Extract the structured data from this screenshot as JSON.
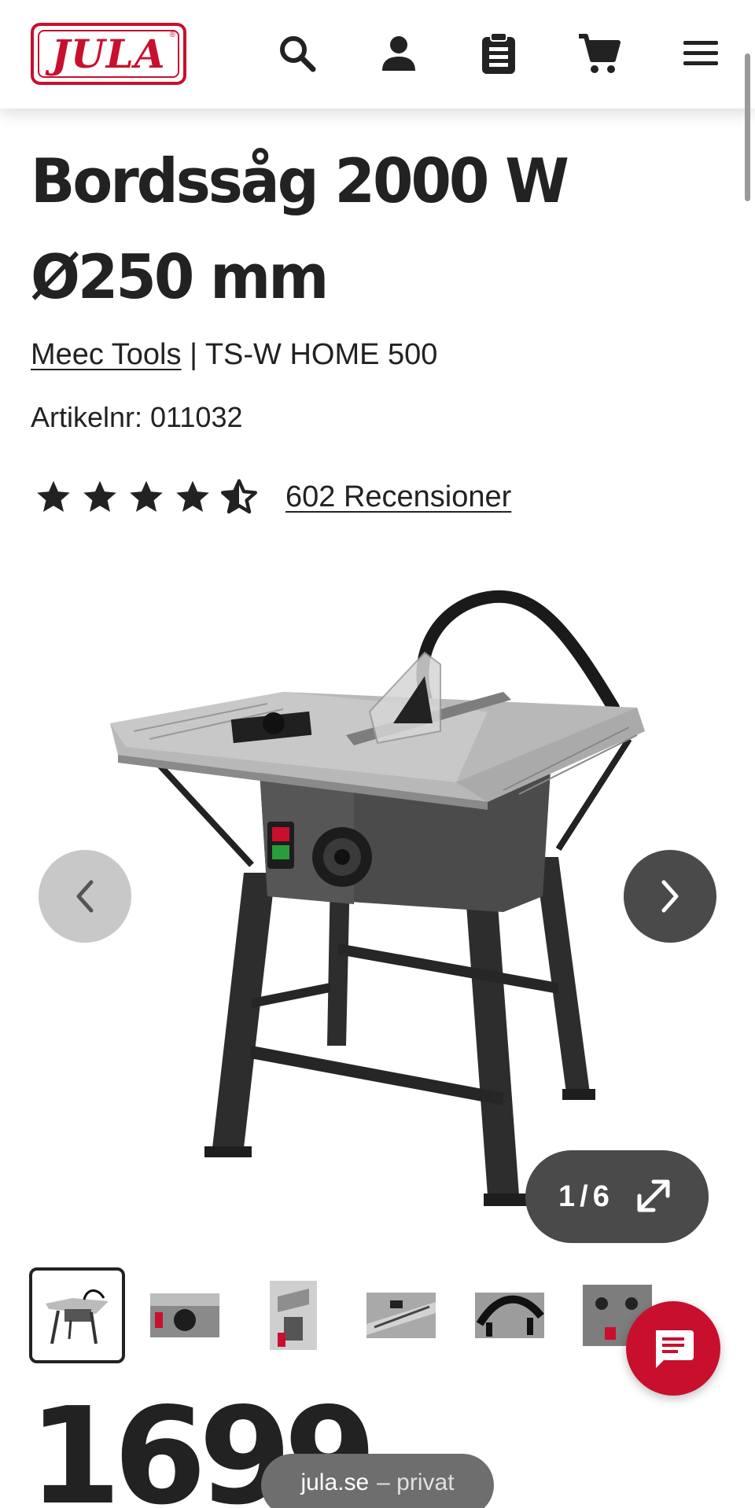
{
  "header": {
    "logo_text": "JULA",
    "icons": [
      "search-icon",
      "account-icon",
      "list-icon",
      "cart-icon",
      "menu-icon"
    ]
  },
  "product": {
    "title_line1": "Bordssåg 2000 W",
    "title_line2": "Ø250 mm",
    "brand": "Meec Tools",
    "separator": "|",
    "model": "TS-W HOME 500",
    "article_number": "Artikelnr: 011032",
    "rating": 4.5,
    "rating_max": 5,
    "reviews_label": "602 Recensioner"
  },
  "gallery": {
    "current": "1",
    "sep": "/",
    "total": "6",
    "thumb_count": 6
  },
  "price": "1699",
  "browser": {
    "domain": "jula.se",
    "suffix": "– privat"
  },
  "colors": {
    "brand_red": "#c8102e",
    "dark": "#222222",
    "button_dark": "#4a4a4a",
    "button_light": "#c8c8c8"
  }
}
